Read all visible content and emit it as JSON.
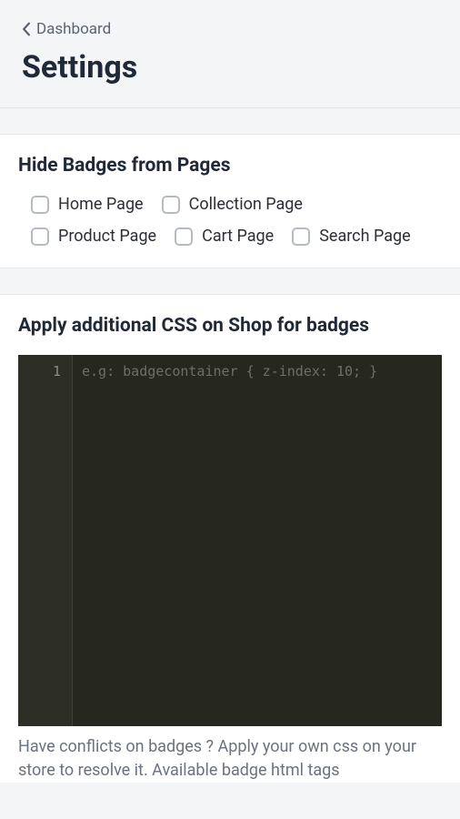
{
  "header": {
    "breadcrumb": "Dashboard",
    "title": "Settings"
  },
  "hideBadges": {
    "title": "Hide Badges from Pages",
    "options": {
      "home": "Home Page",
      "collection": "Collection Page",
      "product": "Product Page",
      "cart": "Cart Page",
      "search": "Search Page"
    }
  },
  "cssSection": {
    "title": "Apply additional CSS on Shop for badges",
    "lineNumber": "1",
    "placeholder": "e.g: badgecontainer { z-index: 10; }",
    "help": "Have conflicts on badges ? Apply your own css on your store to resolve it. Available badge html tags"
  }
}
